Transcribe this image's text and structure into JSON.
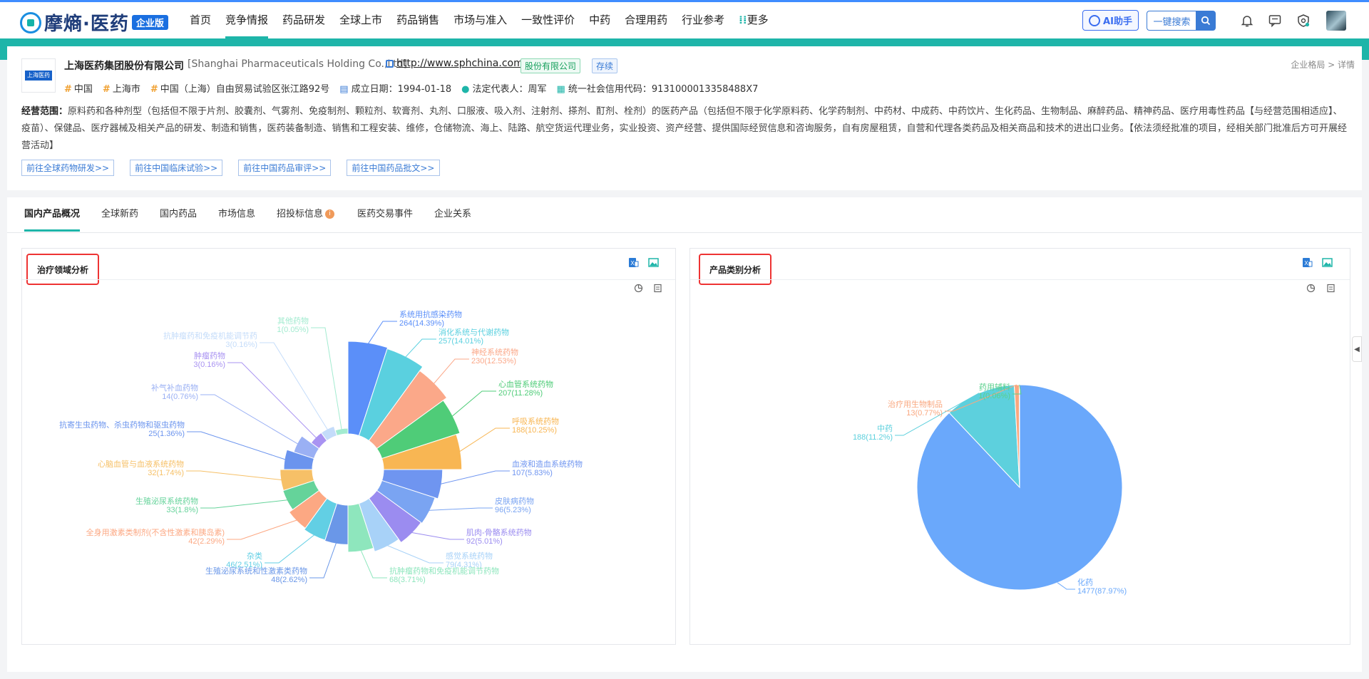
{
  "brand": {
    "name": "摩熵·医药",
    "badge": "企业版"
  },
  "nav": {
    "items": [
      "首页",
      "竞争情报",
      "药品研发",
      "全球上市",
      "药品销售",
      "市场与准入",
      "一致性评价",
      "中药",
      "合理用药",
      "行业参考",
      "更多"
    ],
    "active": "竞争情报"
  },
  "header": {
    "ai_label": "AI助手",
    "search_label": "一键搜索"
  },
  "company": {
    "name": "上海医药集团股份有限公司",
    "name_en": "[Shanghai Pharmaceuticals Holding Co.,Ltd]",
    "url": "http://www.sphchina.com/",
    "tag_type": "股份有限公司",
    "tag_status": "存续",
    "breadcrumb": "企业格局 > 详情",
    "logo_text": "上海医药",
    "country": "中国",
    "city": "上海市",
    "address": "中国（上海）自由贸易试验区张江路92号",
    "founded_label": "成立日期：",
    "founded": "1994-01-18",
    "legal_rep_label": "法定代表人：",
    "legal_rep": "周军",
    "credit_label": "统一社会信用代码：",
    "credit_code": "9131000013358488X7",
    "scope_label": "经营范围：",
    "scope": "原料药和各种剂型（包括但不限于片剂、胶囊剂、气雾剂、免疫制剂、颗粒剂、软膏剂、丸剂、口服液、吸入剂、注射剂、搽剂、酊剂、栓剂）的医药产品（包括但不限于化学原料药、化学药制剂、中药材、中成药、中药饮片、生化药品、生物制品、麻醉药品、精神药品、医疗用毒性药品【与经营范围相适应】、疫苗）、保健品、医疗器械及相关产品的研发、制造和销售，医药装备制造、销售和工程安装、维修，仓储物流、海上、陆路、航空货运代理业务，实业投资、资产经营、提供国际经贸信息和咨询服务，自有房屋租赁，自营和代理各类药品及相关商品和技术的进出口业务。【依法须经批准的项目，经相关部门批准后方可开展经营活动】"
  },
  "go_links": [
    "前往全球药物研发>>",
    "前往中国临床试验>>",
    "前往中国药品审评>>",
    "前往中国药品批文>>"
  ],
  "tabs": [
    "国内产品概况",
    "全球新药",
    "国内药品",
    "市场信息",
    "招投标信息",
    "医药交易事件",
    "企业关系"
  ],
  "tabs_active": "国内产品概况",
  "panels": {
    "left_title": "治疗领域分析",
    "right_title": "产品类别分析"
  },
  "colors": {
    "accent": "#1eb5a9",
    "brand": "#3a7bd5"
  },
  "chart_data": [
    {
      "type": "pie",
      "title": "治疗领域分析",
      "variant": "rose",
      "series": [
        {
          "values": [
            264,
            257,
            230,
            207,
            188,
            107,
            96,
            92,
            79,
            68,
            48,
            46,
            42,
            33,
            32,
            25,
            14,
            3,
            3,
            1
          ]
        }
      ],
      "categories": [
        "系统用抗感染药物",
        "消化系统与代谢药物",
        "神经系统药物",
        "心血管系统药物",
        "呼吸系统药物",
        "血液和造血系统药物",
        "皮肤病药物",
        "肌肉-骨骼系统药物",
        "感觉系统药物",
        "抗肿瘤药物和免疫机能调节药物",
        "生殖泌尿系统和性激素类药物",
        "杂类",
        "全身用激素类制剂(不含性激素和胰岛素)",
        "生殖泌尿系统药物",
        "心脑血管与血液系统药物",
        "抗寄生虫药物、杀虫药物和驱虫药物",
        "补气补血药物",
        "肿瘤药物",
        "抗肿瘤药和免疫机能调节药",
        "其他药物"
      ],
      "labels": [
        "264(14.39%)",
        "257(14.01%)",
        "230(12.53%)",
        "207(11.28%)",
        "188(10.25%)",
        "107(5.83%)",
        "96(5.23%)",
        "92(5.01%)",
        "79(4.31%)",
        "68(3.71%)",
        "48(2.62%)",
        "46(2.51%)",
        "42(2.29%)",
        "33(1.8%)",
        "32(1.74%)",
        "25(1.36%)",
        "14(0.76%)",
        "3(0.16%)",
        "3(0.16%)",
        "1(0.05%)"
      ],
      "colors": [
        "#5b8ff9",
        "#5ad0df",
        "#fba889",
        "#4fcc78",
        "#f8b653",
        "#6f95f0",
        "#7aa4f2",
        "#9b8cf0",
        "#a8d2f8",
        "#8ee6bd",
        "#6a97e8",
        "#62cfe4",
        "#fca883",
        "#65d39a",
        "#f6c067",
        "#6b94ee",
        "#9ab0f4",
        "#a993f2",
        "#c4dcfa",
        "#a3ebd0"
      ]
    },
    {
      "type": "pie",
      "title": "产品类别分析",
      "series": [
        {
          "values": [
            1477,
            188,
            13,
            1
          ]
        }
      ],
      "categories": [
        "化药",
        "中药",
        "治疗用生物制品",
        "药用辅料"
      ],
      "labels": [
        "1477(87.97%)",
        "188(11.2%)",
        "13(0.77%)",
        "1(0.06%)"
      ],
      "colors": [
        "#6aa8fb",
        "#5dd0dd",
        "#f9a77f",
        "#5ad08c"
      ]
    }
  ]
}
